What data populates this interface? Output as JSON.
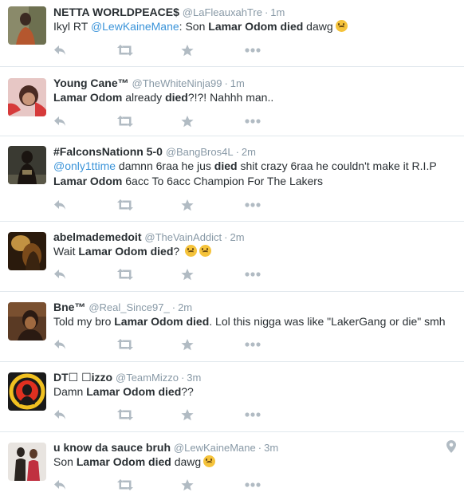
{
  "tweets": [
    {
      "name": "NETTA WORLDPEACE",
      "handle": "@LaFleauxahTre",
      "time": "1m",
      "verified_glyph": "$",
      "segments": [
        {
          "t": "Ikyl RT ",
          "style": "plain"
        },
        {
          "t": "@LewKaineMane",
          "style": "mention"
        },
        {
          "t": ": Son ",
          "style": "plain"
        },
        {
          "t": "Lamar Odom died",
          "style": "bold"
        },
        {
          "t": " dawg",
          "style": "plain"
        }
      ],
      "emoji": [
        "crying-face"
      ],
      "avatar": {
        "bg": "#8a8a6a",
        "fg": "#3b2a22",
        "accent": "#b5572e"
      }
    },
    {
      "name": "Young Cane™",
      "handle": "@TheWhiteNinja99",
      "time": "1m",
      "segments": [
        {
          "t": "Lamar Odom",
          "style": "bold"
        },
        {
          "t": " already ",
          "style": "plain"
        },
        {
          "t": "died",
          "style": "bold"
        },
        {
          "t": "?!?! Nahhh man..",
          "style": "plain"
        }
      ],
      "emoji": [],
      "avatar": {
        "bg": "#e7c7c5",
        "fg": "#4a2b23",
        "accent": "#d63a3a"
      }
    },
    {
      "name": "#FalconsNationn 5-0",
      "handle": "@BangBros4L",
      "time": "2m",
      "segments": [
        {
          "t": "@only1ttime",
          "style": "mention"
        },
        {
          "t": " damnn 6raa he jus ",
          "style": "plain"
        },
        {
          "t": "died",
          "style": "bold"
        },
        {
          "t": " shit crazy 6raa he couldn't make it R.I.P ",
          "style": "plain"
        },
        {
          "t": "Lamar Odom",
          "style": "bold"
        },
        {
          "t": " 6acc To 6acc Champion For The Lakers",
          "style": "plain"
        }
      ],
      "emoji": [],
      "avatar": {
        "bg": "#3a3a32",
        "fg": "#1a1410",
        "accent": "#8a7a55"
      }
    },
    {
      "name": "abelmademedoit",
      "handle": "@TheVainAddict",
      "time": "2m",
      "segments": [
        {
          "t": "Wait ",
          "style": "plain"
        },
        {
          "t": "Lamar Odom died",
          "style": "bold"
        },
        {
          "t": "? ",
          "style": "plain"
        }
      ],
      "emoji": [
        "worried-face",
        "worried-face"
      ],
      "avatar": {
        "bg": "#7a4a1a",
        "fg": "#2a1a0c",
        "accent": "#e8b050"
      }
    },
    {
      "name": "Bne™",
      "handle": "@Real_Since97_",
      "time": "2m",
      "segments": [
        {
          "t": "Told my bro ",
          "style": "plain"
        },
        {
          "t": "Lamar Odom died",
          "style": "bold"
        },
        {
          "t": ". Lol this nigga was like \"LakerGang or die\" smh",
          "style": "plain"
        }
      ],
      "emoji": [],
      "avatar": {
        "bg": "#5a3a24",
        "fg": "#2a1a12",
        "accent": "#a06a40"
      }
    },
    {
      "name": "DT☐ ☐izzo",
      "handle": "@TeamMizzo",
      "time": "3m",
      "segments": [
        {
          "t": "Damn ",
          "style": "plain"
        },
        {
          "t": "Lamar Odom died",
          "style": "bold"
        },
        {
          "t": "??",
          "style": "plain"
        }
      ],
      "emoji": [],
      "avatar": {
        "bg": "#1a1a1a",
        "fg": "#f0c020",
        "accent": "#e03020"
      }
    },
    {
      "name": "u know da sauce bruh",
      "handle": "@LewKaineMane",
      "time": "3m",
      "segments": [
        {
          "t": "Son ",
          "style": "plain"
        },
        {
          "t": "Lamar Odom died",
          "style": "bold"
        },
        {
          "t": " dawg",
          "style": "plain"
        }
      ],
      "emoji": [
        "crying-face"
      ],
      "has_location_pin": true,
      "avatar": {
        "bg": "#e8e4e0",
        "fg": "#2a2420",
        "accent": "#c03040"
      }
    }
  ],
  "icons": {
    "reply": "reply-icon",
    "retweet": "retweet-icon",
    "favorite": "star-icon",
    "more": "more-icon",
    "location": "location-pin-icon"
  },
  "colors": {
    "icon": "#b1bbc3",
    "mention": "#3b94d9",
    "meta": "#8899a6",
    "divider": "#e1e8ed"
  }
}
